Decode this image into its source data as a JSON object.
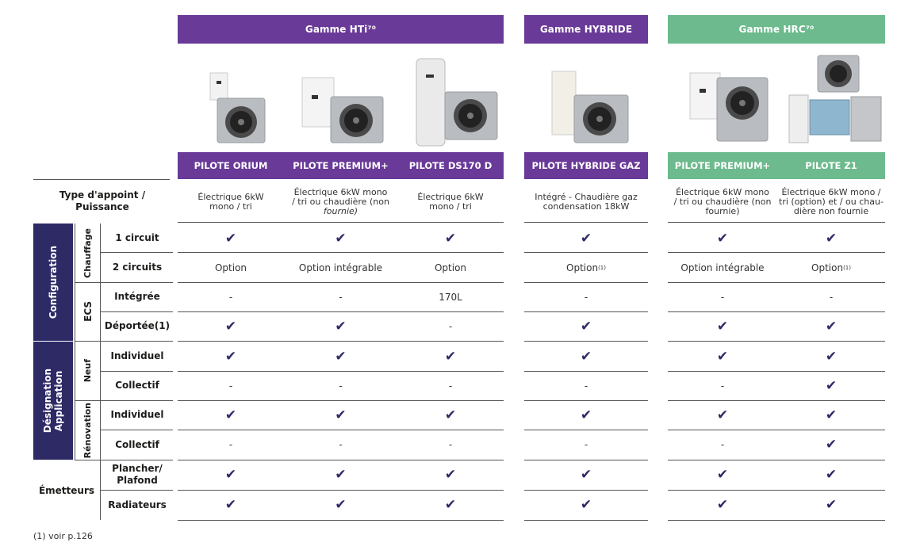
{
  "groups": {
    "hti": "Gamme HTi⁷⁰",
    "hybride": "Gamme HYBRIDE",
    "hrc": "Gamme HRC⁷⁰"
  },
  "models": [
    "PILOTE ORIUM",
    "PILOTE PREMIUM+",
    "PILOTE DS170 D",
    "PILOTE HYBRIDE GAZ",
    "PILOTE PREMIUM+",
    "PILOTE Z1"
  ],
  "appoint_label": "Type d'appoint / Puissance",
  "appoint": [
    [
      "Électrique 6kW",
      "mono / tri",
      ""
    ],
    [
      "Électrique 6kW mono",
      "/ tri ou chaudière (non",
      "fournie)"
    ],
    [
      "Électrique 6kW",
      "mono / tri",
      ""
    ],
    [
      "Intégré - Chaudière gaz",
      "condensation 18kW",
      ""
    ],
    [
      "Électrique 6kW mono",
      "/ tri ou chaudière (non",
      "fournie)"
    ],
    [
      "Électrique 6kW mono /",
      "tri (option) et / ou chau-",
      "dière non fournie"
    ]
  ],
  "sections": {
    "configuration": "Configuration",
    "designation": "Désignation Application",
    "designation_l1": "Désignation",
    "designation_l2": "Application",
    "chauffage": "Chauffage",
    "ecs": "ECS",
    "neuf": "Neuf",
    "renovation": "Rénovation",
    "emetteurs": "Émetteurs"
  },
  "rows": [
    {
      "label": "1 circuit",
      "values": [
        "✔",
        "✔",
        "✔",
        "✔",
        "✔",
        "✔"
      ]
    },
    {
      "label": "2 circuits",
      "values": [
        "Option",
        "Option intégrable",
        "Option",
        "Option(1)",
        "Option intégrable",
        "Option(1)"
      ]
    },
    {
      "label": "Intégrée",
      "values": [
        "-",
        "-",
        "170L",
        "-",
        "-",
        "-"
      ]
    },
    {
      "label": "Déportée(1)",
      "values": [
        "✔",
        "✔",
        "-",
        "✔",
        "✔",
        "✔"
      ]
    },
    {
      "label": "Individuel",
      "values": [
        "✔",
        "✔",
        "✔",
        "✔",
        "✔",
        "✔"
      ]
    },
    {
      "label": "Collectif",
      "values": [
        "-",
        "-",
        "-",
        "-",
        "-",
        "✔"
      ]
    },
    {
      "label": "Individuel",
      "values": [
        "✔",
        "✔",
        "✔",
        "✔",
        "✔",
        "✔"
      ]
    },
    {
      "label": "Collectif",
      "values": [
        "-",
        "-",
        "-",
        "-",
        "-",
        "✔"
      ]
    },
    {
      "label": "Plancher/ Plafond",
      "values": [
        "✔",
        "✔",
        "✔",
        "✔",
        "✔",
        "✔"
      ]
    },
    {
      "label": "Radiateurs",
      "values": [
        "✔",
        "✔",
        "✔",
        "✔",
        "✔",
        "✔"
      ]
    }
  ],
  "footnote": "(1) voir p.126",
  "colors": {
    "hti": "#6a3a98",
    "hrc": "#6cba8d",
    "navy": "#2d2a66"
  }
}
